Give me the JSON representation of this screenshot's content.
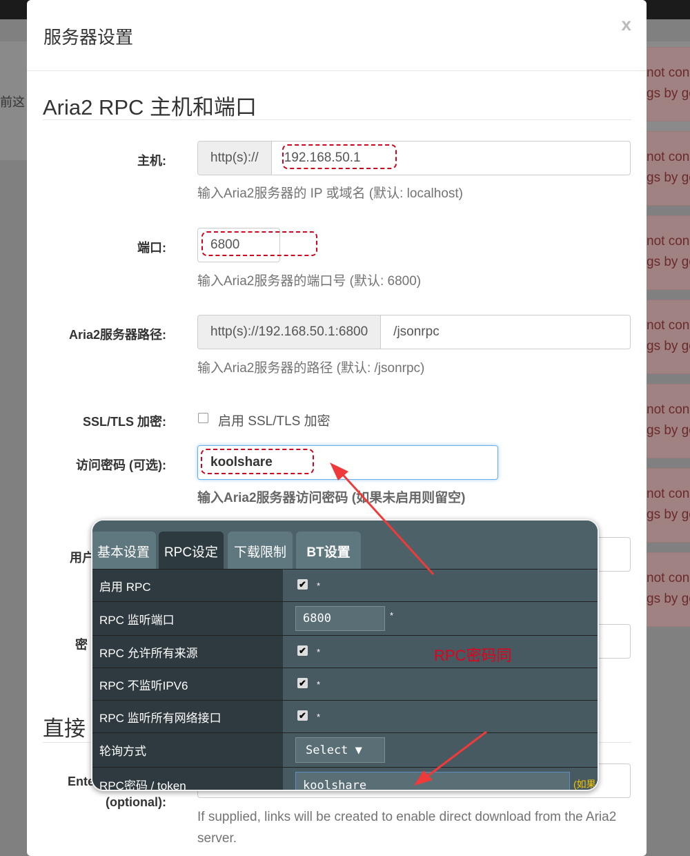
{
  "background": {
    "left_fragment": "前这",
    "alerts": [
      {
        "line1": "not con",
        "line2": "gs by go"
      },
      {
        "line1": "not con",
        "line2": "gs by go"
      },
      {
        "line1": "not con",
        "line2": "gs by go"
      },
      {
        "line1": "not con",
        "line2": "gs by go"
      },
      {
        "line1": "not con",
        "line2": "gs by go"
      },
      {
        "line1": "not con",
        "line2": "gs by go"
      },
      {
        "line1": "not con",
        "line2": "gs by go"
      }
    ]
  },
  "modal": {
    "title": "服务器设置",
    "close": "x",
    "section1": "Aria2 RPC 主机和端口",
    "host": {
      "label": "主机:",
      "prefix": "http(s)://",
      "value": "192.168.50.1",
      "help": "输入Aria2服务器的 IP 或域名 (默认: localhost)"
    },
    "port": {
      "label": "端口:",
      "value": "6800",
      "help": "输入Aria2服务器的端口号 (默认: 6800)"
    },
    "path": {
      "label": "Aria2服务器路径:",
      "prefix": "http(s)://192.168.50.1:6800",
      "value": "/jsonrpc",
      "help": "输入Aria2服务器的路径 (默认: /jsonrpc)"
    },
    "ssl": {
      "label": "SSL/TLS 加密:",
      "checkbox_label": "启用 SSL/TLS 加密",
      "checked": false
    },
    "secret": {
      "label": "访问密码 (可选):",
      "value": "koolshare",
      "help": "输入Aria2服务器访问密码 (如果未启用则留空)"
    },
    "user_label_fragment": "用户",
    "pass_label_fragment": "密",
    "section2_fragment": "直接",
    "direct": {
      "label_fragment": "Ente",
      "label2": "(optional):",
      "help": "If supplied, links will be created to enable direct download from the Aria2 server."
    }
  },
  "overlay": {
    "tabs": [
      "基本设置",
      "RPC设定",
      "下载限制",
      "BT设置"
    ],
    "active_tab": "RPC设定",
    "rows": [
      {
        "label": "启用 RPC",
        "type": "checkbox",
        "checked": true,
        "mark": "*"
      },
      {
        "label": "RPC 监听端口",
        "type": "input",
        "value": "6800",
        "mark": "*"
      },
      {
        "label": "RPC 允许所有来源",
        "type": "checkbox",
        "checked": true,
        "mark": "*"
      },
      {
        "label": "RPC 不监听IPV6",
        "type": "checkbox",
        "checked": true,
        "mark": "*"
      },
      {
        "label": "RPC 监听所有网络接口",
        "type": "checkbox",
        "checked": true,
        "mark": "*"
      },
      {
        "label": "轮询方式",
        "type": "select",
        "value": "Select ▼"
      },
      {
        "label": "RPC密码 / token",
        "type": "input",
        "value": "koolshare",
        "note": "(如果"
      }
    ],
    "annotation": "RPC密码同",
    "annotation_color": "#e2001a"
  }
}
